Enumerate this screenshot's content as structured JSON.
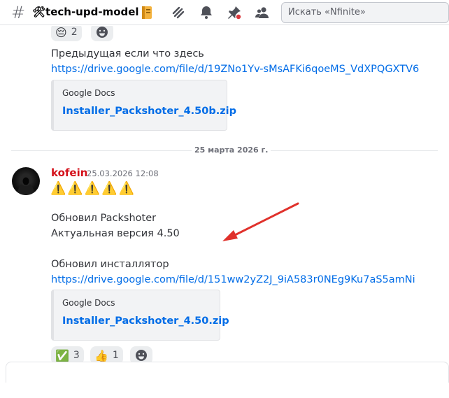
{
  "header": {
    "hash_symbol": "#",
    "channel_name": "🛠tech-upd-model",
    "search_placeholder": "Искать «Nfinite»",
    "icons": [
      "threads-icon",
      "mute-icon",
      "notifications-bell-icon",
      "pinned-messages-icon",
      "member-list-icon",
      "search-icon"
    ]
  },
  "messages": {
    "prev": {
      "reaction": {
        "emoji": "😔",
        "count": "2"
      },
      "text": "Предыдущая если что здесь",
      "link": "https://drive.google.com/file/d/19ZNo1Yv-sMsAFKi6qoeMS_VdXPQGXTV6",
      "embed": {
        "provider": "Google Docs",
        "title": "Installer_Packshoter_4.50b.zip"
      }
    },
    "divider": {
      "label": "25 марта 2026 г."
    },
    "main": {
      "author": "kofein",
      "timestamp": "25.03.2026 12:08",
      "warnings": "⚠️⚠️⚠️⚠️⚠️",
      "line1": "Обновил Packshoter",
      "line2": "Актуальная версия 4.50",
      "line3": "Обновил инсталлятор",
      "link": "https://drive.google.com/file/d/151ww2yZ2J_9iA583r0NEg9Ku7aS5amNi",
      "embed": {
        "provider": "Google Docs",
        "title": "Installer_Packshoter_4.50.zip"
      },
      "reactions": [
        {
          "emoji": "✅",
          "count": "3"
        },
        {
          "emoji": "👍",
          "count": "1"
        }
      ]
    }
  },
  "colors": {
    "link": "#006ce7",
    "author": "#d4111b",
    "arrow": "#e0312b"
  }
}
